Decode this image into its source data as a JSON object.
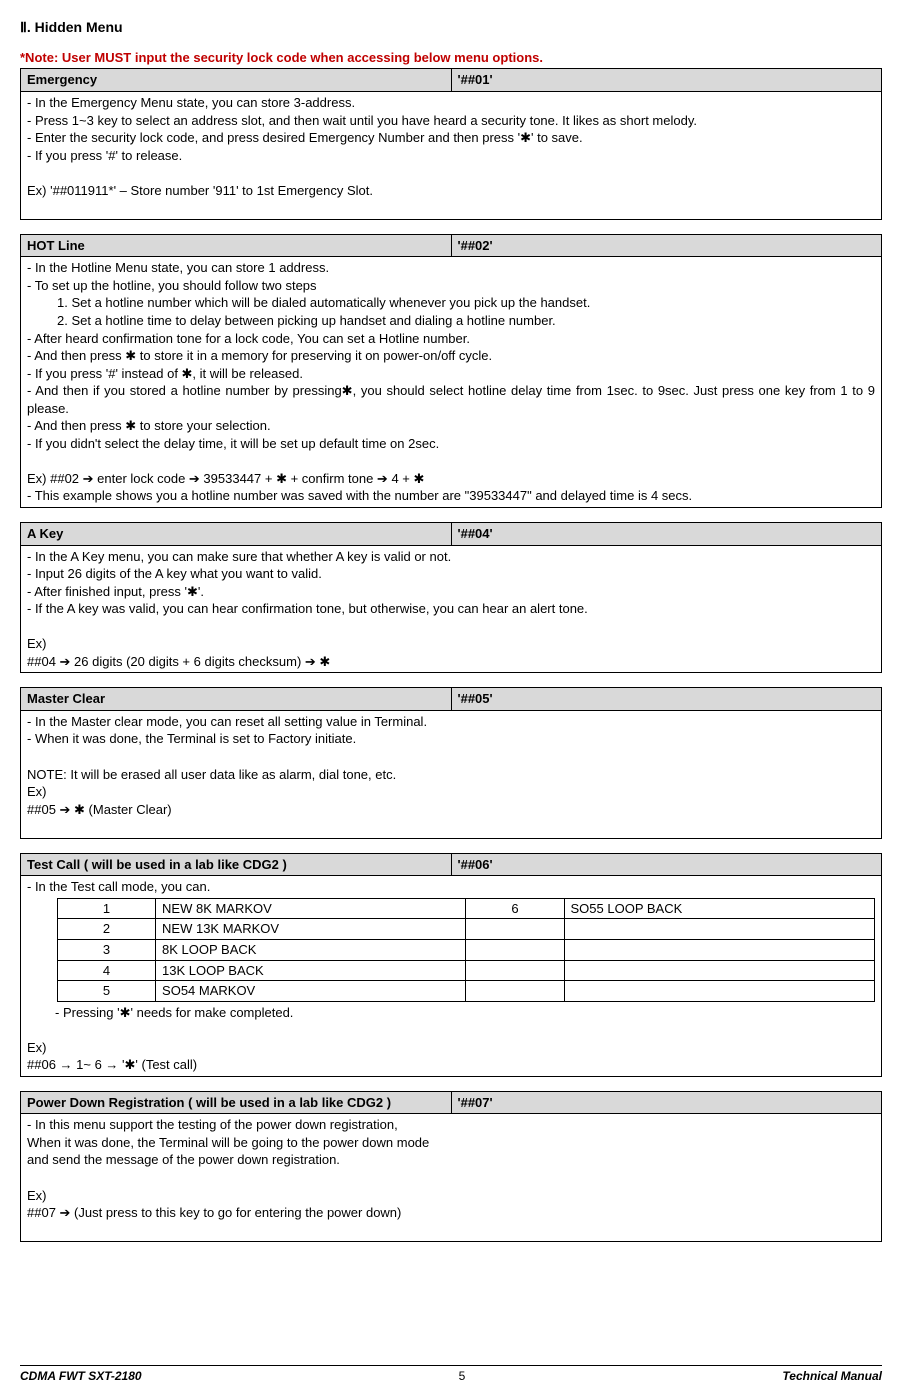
{
  "title": "Ⅱ. Hidden Menu",
  "note": "*Note: User MUST input the security lock code when accessing below menu options.",
  "emergency": {
    "name": "Emergency",
    "code": "'##01'",
    "l1": "- In the Emergency Menu state, you can store 3-address.",
    "l2": "- Press 1~3 key to select an address slot, and then wait until you have heard a security tone. It likes as short melody.",
    "l3": "- Enter the security lock code, and press desired Emergency Number and then press '✱' to save.",
    "l4": "- If you press '#' to release.",
    "l5": "Ex) '##011911*' – Store number '911' to 1st Emergency Slot."
  },
  "hotline": {
    "name": "HOT Line",
    "code": "'##02'",
    "l1": "- In the Hotline Menu state, you can store 1 address.",
    "l2": "- To set up the hotline, you should follow two steps",
    "l2a": "1. Set a hotline number which will be dialed automatically whenever you pick up the handset.",
    "l2b": "2. Set a hotline time to delay between picking up handset and dialing a hotline number.",
    "l3": "- After heard confirmation tone for a lock code, You can set a Hotline number.",
    "l4": "- And then press ✱ to store it in a memory for preserving it on power-on/off cycle.",
    "l5": "- If you press '#' instead of ✱, it will be released.",
    "l6": "- And then if you stored a hotline number by pressing✱, you should select hotline delay time from 1sec. to 9sec. Just press one key from 1 to 9 please.",
    "l7": "- And then press ✱ to store your selection.",
    "l8": "- If you didn't select the delay time, it will be set up default time on 2sec.",
    "l9": "Ex) ##02 ➔ enter lock code ➔ 39533447 + ✱ + confirm tone ➔ 4 + ✱",
    "l10": "- This example shows you a hotline number was saved with the number are \"39533447\" and delayed time is 4 secs."
  },
  "akey": {
    "name": "A Key",
    "code": "'##04'",
    "l1": "- In the A Key menu, you can make sure that whether A key is valid or not.",
    "l2": "- Input 26 digits of the A key what you want to valid.",
    "l3": "- After finished input, press '✱'.",
    "l4": "- If the A key was valid, you can hear confirmation tone, but otherwise, you can hear an alert tone.",
    "l5": "Ex)",
    "l6": "##04 ➔ 26 digits (20 digits + 6 digits checksum) ➔ ✱"
  },
  "master": {
    "name": "Master Clear",
    "code": "'##05'",
    "l1": "- In the Master clear mode, you can reset all setting value in Terminal.",
    "l2": "- When it was done, the Terminal is set to Factory initiate.",
    "l3": "NOTE: It will be erased all user data like as alarm, dial tone, etc.",
    "l4": "Ex)",
    "l5": "##05 ➔ ✱ (Master Clear)"
  },
  "testcall": {
    "name": "Test Call ( will be used in a lab like CDG2 )",
    "code": "'##06'",
    "l1": "- In the Test call mode, you can.",
    "rows": [
      {
        "n1": "1",
        "v1": "NEW 8K MARKOV",
        "n2": "6",
        "v2": "SO55 LOOP BACK"
      },
      {
        "n1": "2",
        "v1": "NEW 13K MARKOV",
        "n2": "",
        "v2": ""
      },
      {
        "n1": "3",
        "v1": "8K LOOP BACK",
        "n2": "",
        "v2": ""
      },
      {
        "n1": "4",
        "v1": "13K LOOP BACK",
        "n2": "",
        "v2": ""
      },
      {
        "n1": "5",
        "v1": "SO54 MARKOV",
        "n2": "",
        "v2": ""
      }
    ],
    "dash": "-    Pressing '✱' needs for make completed.",
    "l2": "Ex)",
    "l3": "##06 → 1~ 6 → '✱' (Test call)"
  },
  "powerdown": {
    "name": "Power Down Registration ( will be used in a lab like CDG2 )",
    "code": "'##07'",
    "l1": "- In this menu support the testing of the power down registration,",
    "l2": "  When it was done, the Terminal will be going to the power down mode",
    "l3": "  and send the message of the power down registration.",
    "l4": "Ex)",
    "l5": "##07 ➔ (Just press to this key to go for entering the power down)"
  },
  "footer": {
    "left": "CDMA FWT SXT-2180",
    "center": "5",
    "right": "Technical Manual"
  }
}
